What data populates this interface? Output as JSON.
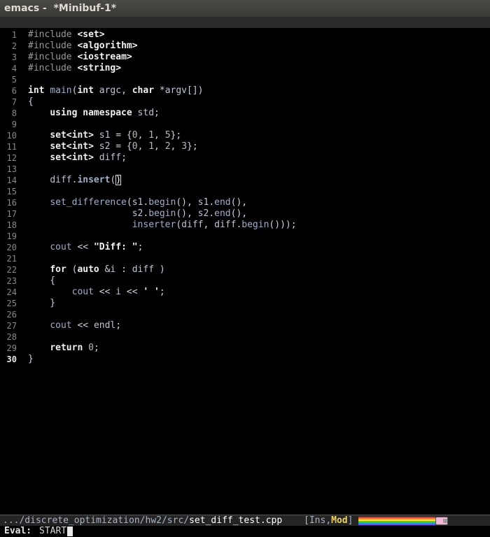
{
  "window": {
    "title": "emacs -  *Minibuf-1*"
  },
  "colors": {
    "background": "#000000",
    "titlebar": "#3b3a36",
    "mode_line": "#242424",
    "modified_flag": "#f0d25a"
  },
  "editor": {
    "current_line": 30,
    "lines": [
      {
        "n": "1",
        "tokens": [
          {
            "c": "t-pp",
            "t": "#include "
          },
          {
            "c": "t-inc",
            "t": "<set>"
          }
        ]
      },
      {
        "n": "2",
        "tokens": [
          {
            "c": "t-pp",
            "t": "#include "
          },
          {
            "c": "t-inc",
            "t": "<algorithm>"
          }
        ]
      },
      {
        "n": "3",
        "tokens": [
          {
            "c": "t-pp",
            "t": "#include "
          },
          {
            "c": "t-inc",
            "t": "<iostream>"
          }
        ]
      },
      {
        "n": "4",
        "tokens": [
          {
            "c": "t-pp",
            "t": "#include "
          },
          {
            "c": "t-inc",
            "t": "<string>"
          }
        ]
      },
      {
        "n": "5",
        "tokens": []
      },
      {
        "n": "6",
        "tokens": [
          {
            "c": "t-ty",
            "t": "int"
          },
          {
            "c": "t-p",
            "t": " "
          },
          {
            "c": "t-fn",
            "t": "main"
          },
          {
            "c": "t-p",
            "t": "("
          },
          {
            "c": "t-ty",
            "t": "int"
          },
          {
            "c": "t-var",
            "t": " argc"
          },
          {
            "c": "t-p",
            "t": ", "
          },
          {
            "c": "t-ty",
            "t": "char"
          },
          {
            "c": "t-p",
            "t": " *"
          },
          {
            "c": "t-var",
            "t": "argv"
          },
          {
            "c": "t-p",
            "t": "[])"
          }
        ]
      },
      {
        "n": "7",
        "tokens": [
          {
            "c": "t-p",
            "t": "{"
          }
        ]
      },
      {
        "n": "8",
        "tokens": [
          {
            "c": "t-p",
            "t": "    "
          },
          {
            "c": "t-kw",
            "t": "using namespace"
          },
          {
            "c": "t-var",
            "t": " std"
          },
          {
            "c": "t-p",
            "t": ";"
          }
        ]
      },
      {
        "n": "9",
        "tokens": []
      },
      {
        "n": "10",
        "tokens": [
          {
            "c": "t-p",
            "t": "    "
          },
          {
            "c": "t-ty",
            "t": "set<int>"
          },
          {
            "c": "t-var",
            "t": " s1"
          },
          {
            "c": "t-p",
            "t": " = {"
          },
          {
            "c": "t-num",
            "t": "0"
          },
          {
            "c": "t-p",
            "t": ", "
          },
          {
            "c": "t-num",
            "t": "1"
          },
          {
            "c": "t-p",
            "t": ", "
          },
          {
            "c": "t-num",
            "t": "5"
          },
          {
            "c": "t-p",
            "t": "};"
          }
        ]
      },
      {
        "n": "11",
        "tokens": [
          {
            "c": "t-p",
            "t": "    "
          },
          {
            "c": "t-ty",
            "t": "set<int>"
          },
          {
            "c": "t-var",
            "t": " s2"
          },
          {
            "c": "t-p",
            "t": " = {"
          },
          {
            "c": "t-num",
            "t": "0"
          },
          {
            "c": "t-p",
            "t": ", "
          },
          {
            "c": "t-num",
            "t": "1"
          },
          {
            "c": "t-p",
            "t": ", "
          },
          {
            "c": "t-num",
            "t": "2"
          },
          {
            "c": "t-p",
            "t": ", "
          },
          {
            "c": "t-num",
            "t": "3"
          },
          {
            "c": "t-p",
            "t": "};"
          }
        ]
      },
      {
        "n": "12",
        "tokens": [
          {
            "c": "t-p",
            "t": "    "
          },
          {
            "c": "t-ty",
            "t": "set<int>"
          },
          {
            "c": "t-var",
            "t": " diff"
          },
          {
            "c": "t-p",
            "t": ";"
          }
        ]
      },
      {
        "n": "13",
        "tokens": []
      },
      {
        "n": "14",
        "tokens": [
          {
            "c": "t-p",
            "t": "    "
          },
          {
            "c": "t-var",
            "t": "diff"
          },
          {
            "c": "t-p",
            "t": "."
          },
          {
            "c": "t-fb",
            "t": "insert"
          },
          {
            "c": "t-p",
            "t": "("
          },
          {
            "c": "t-cursor",
            "t": ")"
          }
        ]
      },
      {
        "n": "15",
        "tokens": []
      },
      {
        "n": "16",
        "tokens": [
          {
            "c": "t-p",
            "t": "    "
          },
          {
            "c": "t-fn",
            "t": "set_difference"
          },
          {
            "c": "t-p",
            "t": "("
          },
          {
            "c": "t-var",
            "t": "s1"
          },
          {
            "c": "t-p",
            "t": "."
          },
          {
            "c": "t-fn",
            "t": "begin"
          },
          {
            "c": "t-p",
            "t": "(), "
          },
          {
            "c": "t-var",
            "t": "s1"
          },
          {
            "c": "t-p",
            "t": "."
          },
          {
            "c": "t-fn",
            "t": "end"
          },
          {
            "c": "t-p",
            "t": "(),"
          }
        ]
      },
      {
        "n": "17",
        "tokens": [
          {
            "c": "t-p",
            "t": "                   "
          },
          {
            "c": "t-var",
            "t": "s2"
          },
          {
            "c": "t-p",
            "t": "."
          },
          {
            "c": "t-fn",
            "t": "begin"
          },
          {
            "c": "t-p",
            "t": "(), "
          },
          {
            "c": "t-var",
            "t": "s2"
          },
          {
            "c": "t-p",
            "t": "."
          },
          {
            "c": "t-fn",
            "t": "end"
          },
          {
            "c": "t-p",
            "t": "(),"
          }
        ]
      },
      {
        "n": "18",
        "tokens": [
          {
            "c": "t-p",
            "t": "                   "
          },
          {
            "c": "t-fn",
            "t": "inserter"
          },
          {
            "c": "t-p",
            "t": "("
          },
          {
            "c": "t-var",
            "t": "diff"
          },
          {
            "c": "t-p",
            "t": ", "
          },
          {
            "c": "t-var",
            "t": "diff"
          },
          {
            "c": "t-p",
            "t": "."
          },
          {
            "c": "t-fn",
            "t": "begin"
          },
          {
            "c": "t-p",
            "t": "()));"
          }
        ]
      },
      {
        "n": "19",
        "tokens": []
      },
      {
        "n": "20",
        "tokens": [
          {
            "c": "t-p",
            "t": "    "
          },
          {
            "c": "t-fn",
            "t": "cout"
          },
          {
            "c": "t-p",
            "t": " << "
          },
          {
            "c": "t-str",
            "t": "\"Diff: \""
          },
          {
            "c": "t-p",
            "t": ";"
          }
        ]
      },
      {
        "n": "21",
        "tokens": []
      },
      {
        "n": "22",
        "tokens": [
          {
            "c": "t-p",
            "t": "    "
          },
          {
            "c": "t-kw",
            "t": "for"
          },
          {
            "c": "t-p",
            "t": " ("
          },
          {
            "c": "t-kw",
            "t": "auto"
          },
          {
            "c": "t-p",
            "t": " &"
          },
          {
            "c": "t-var",
            "t": "i"
          },
          {
            "c": "t-p",
            "t": " : "
          },
          {
            "c": "t-var",
            "t": "diff"
          },
          {
            "c": "t-p",
            "t": " )"
          }
        ]
      },
      {
        "n": "23",
        "tokens": [
          {
            "c": "t-p",
            "t": "    {"
          }
        ]
      },
      {
        "n": "24",
        "tokens": [
          {
            "c": "t-p",
            "t": "        "
          },
          {
            "c": "t-fn",
            "t": "cout"
          },
          {
            "c": "t-p",
            "t": " << "
          },
          {
            "c": "t-var",
            "t": "i"
          },
          {
            "c": "t-p",
            "t": " << "
          },
          {
            "c": "t-str",
            "t": "' '"
          },
          {
            "c": "t-p",
            "t": ";"
          }
        ]
      },
      {
        "n": "25",
        "tokens": [
          {
            "c": "t-p",
            "t": "    }"
          }
        ]
      },
      {
        "n": "26",
        "tokens": []
      },
      {
        "n": "27",
        "tokens": [
          {
            "c": "t-p",
            "t": "    "
          },
          {
            "c": "t-fn",
            "t": "cout"
          },
          {
            "c": "t-p",
            "t": " << "
          },
          {
            "c": "t-var",
            "t": "endl"
          },
          {
            "c": "t-p",
            "t": ";"
          }
        ]
      },
      {
        "n": "28",
        "tokens": []
      },
      {
        "n": "29",
        "tokens": [
          {
            "c": "t-p",
            "t": "    "
          },
          {
            "c": "t-kw",
            "t": "return"
          },
          {
            "c": "t-p",
            "t": " "
          },
          {
            "c": "t-num",
            "t": "0"
          },
          {
            "c": "t-p",
            "t": ";"
          }
        ]
      },
      {
        "n": "30",
        "tokens": [
          {
            "c": "t-p",
            "t": "}"
          }
        ]
      }
    ]
  },
  "mode_line": {
    "path": ".../discrete_optimization/hw2/src/",
    "file": "set_diff_test.cpp",
    "bracket_open": "[",
    "insert_state": "Ins",
    "separator": ",",
    "modified_state": "Mod",
    "bracket_close": "]",
    "nyan_icon": "nyan-cat-icon"
  },
  "minibuffer": {
    "prompt": "Eval:",
    "input": "START"
  }
}
